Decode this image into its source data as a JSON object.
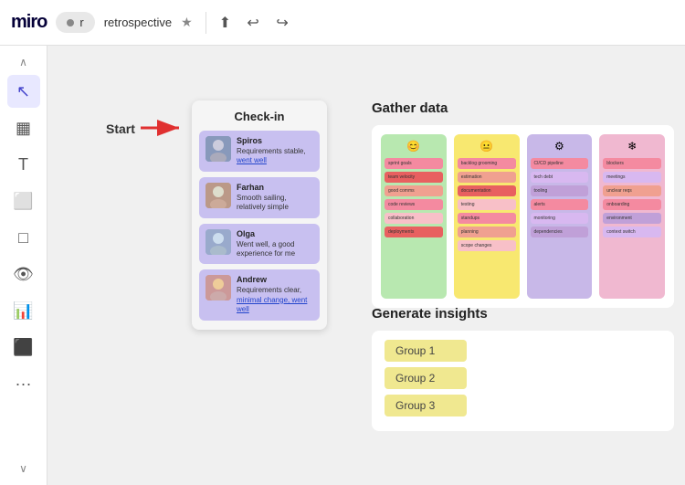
{
  "topbar": {
    "logo": "miro",
    "tab_indicator": "r",
    "tab_name": "retrospective",
    "star_icon": "★",
    "upload_icon": "⬆",
    "undo_icon": "↩",
    "redo_icon": "↪"
  },
  "toolbar": {
    "chevron_up": "∧",
    "cursor_icon": "▲",
    "table_icon": "▦",
    "text_icon": "T",
    "sticky_icon": "▭",
    "shape_icon": "□",
    "eye_icon": "👁",
    "chart_icon": "▊",
    "frame_icon": "▣",
    "more_icon": "•••",
    "chevron_down": "∨"
  },
  "canvas": {
    "start_label": "Start",
    "checkin": {
      "title": "Check-in",
      "cards": [
        {
          "name": "Spiros",
          "text": "Requirements stable, went well",
          "highlight": "went well",
          "avatar_color": "#8899bb"
        },
        {
          "name": "Farhan",
          "text": "Smooth sailing, relatively simple",
          "avatar_color": "#bb9988"
        },
        {
          "name": "Olga",
          "text": "Went well, a good experience for me",
          "avatar_color": "#99aacc"
        },
        {
          "name": "Andrew",
          "text": "Requirements clear, minimal change, went well",
          "highlight": "minimal change, went well",
          "avatar_color": "#cc9999"
        }
      ]
    },
    "gather_data": {
      "title": "Gather data",
      "columns": [
        {
          "emoji": "😊",
          "color": "green"
        },
        {
          "emoji": "😐",
          "color": "yellow"
        },
        {
          "emoji": "⚙",
          "color": "purple"
        },
        {
          "emoji": "❄",
          "color": "pink"
        }
      ]
    },
    "generate_insights": {
      "title": "Generate insights",
      "groups": [
        {
          "label": "Group 1"
        },
        {
          "label": "Group 2"
        },
        {
          "label": "Group 3"
        }
      ]
    }
  }
}
